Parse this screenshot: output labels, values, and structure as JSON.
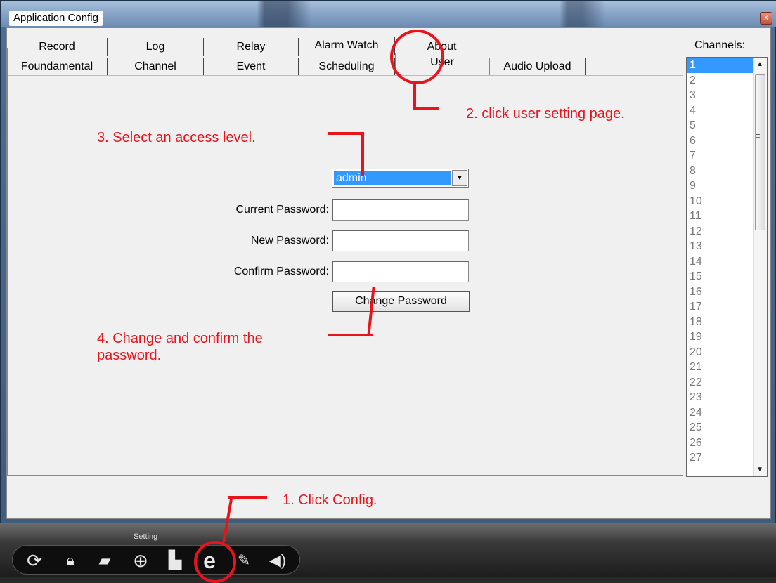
{
  "window": {
    "title": "Application Config",
    "close": "x"
  },
  "tabs": {
    "row_top": [
      "Record",
      "Log",
      "Relay",
      "Alarm Watch",
      "About"
    ],
    "row_bottom": [
      "Foundamental",
      "Channel",
      "Event",
      "Scheduling",
      "User",
      "Audio Upload"
    ],
    "active": "User"
  },
  "channels": {
    "label": "Channels:",
    "items": [
      "1",
      "2",
      "3",
      "4",
      "5",
      "6",
      "7",
      "8",
      "9",
      "10",
      "11",
      "12",
      "13",
      "14",
      "15",
      "16",
      "17",
      "18",
      "19",
      "20",
      "21",
      "22",
      "23",
      "24",
      "25",
      "26",
      "27"
    ],
    "selected": "1"
  },
  "user_form": {
    "access_level": "admin",
    "current_password_label": "Current Password:",
    "new_password_label": "New Password:",
    "confirm_password_label": "Confirm Password:",
    "change_button": "Change Password"
  },
  "annotations": {
    "step1": "1. Click Config.",
    "step2": "2. click user setting page.",
    "step3": "3. Select an access level.",
    "step4_line1": "4. Change and confirm the",
    "step4_line2": "password.",
    "color": "#e8141c"
  },
  "toolbar": {
    "label": "Setting",
    "icons": [
      "refresh-icon",
      "lock-icon",
      "folder-icon",
      "globe-icon",
      "document-icon",
      "config-e-icon",
      "wrench-icon",
      "speaker-icon"
    ]
  }
}
